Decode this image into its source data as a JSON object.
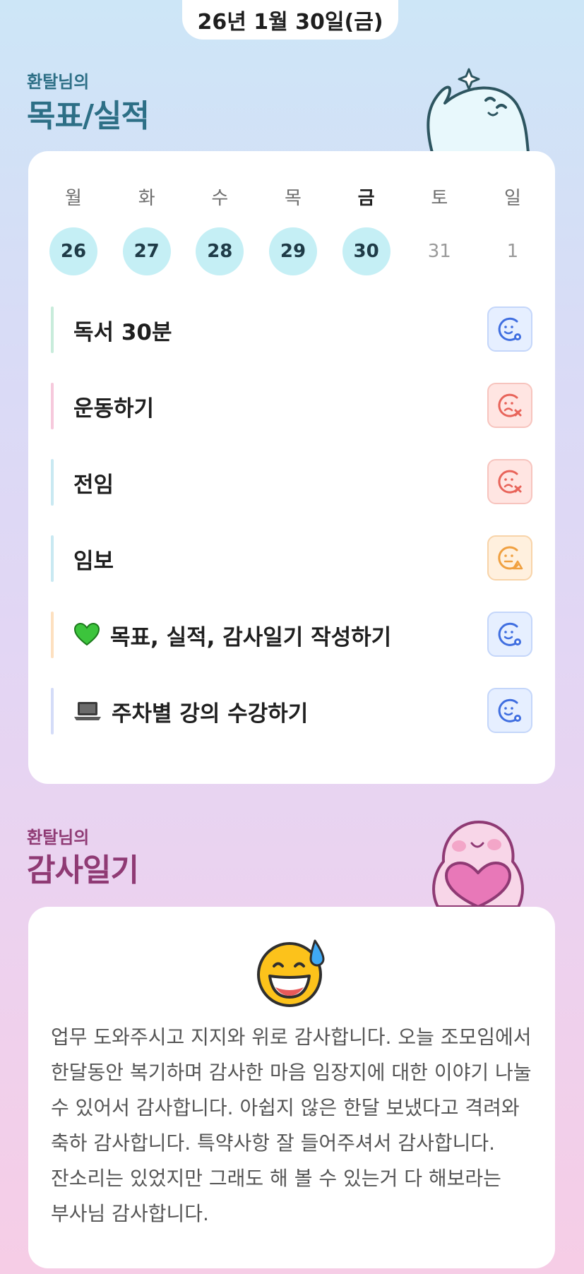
{
  "header": {
    "date": "26년 1월 30일(금)"
  },
  "goals_section": {
    "owner_label": "환탈님의",
    "title": "목표/실적"
  },
  "calendar": {
    "weekdays": [
      "월",
      "화",
      "수",
      "목",
      "금",
      "토",
      "일"
    ],
    "dates": [
      "26",
      "27",
      "28",
      "29",
      "30",
      "31",
      "1"
    ],
    "today_index": 4
  },
  "goals": [
    {
      "label": "독서 30분",
      "status": "success",
      "bar_color": "#c8ecdb"
    },
    {
      "label": "운동하기",
      "status": "fail",
      "bar_color": "#f6c9dc"
    },
    {
      "label": "전임",
      "status": "fail",
      "bar_color": "#c9e9f2"
    },
    {
      "label": "임보",
      "status": "partial",
      "bar_color": "#c9e9f2"
    },
    {
      "label": "목표, 실적, 감사일기 작성하기",
      "emoji": "green-heart-icon",
      "status": "success",
      "bar_color": "#fde0c0"
    },
    {
      "label": "주차별 강의 수강하기",
      "emoji": "laptop-icon",
      "status": "success",
      "bar_color": "#d4dcf8"
    }
  ],
  "status_colors": {
    "success": "#3f6ee0",
    "fail": "#e8645a",
    "partial": "#f0a040"
  },
  "gratitude_section": {
    "owner_label": "환탈님의",
    "title": "감사일기"
  },
  "gratitude": {
    "mood_icon": "grinning-sweat-face-icon",
    "text": "업무 도와주시고 지지와 위로 감사합니다. 오늘 조모임에서 한달동안 복기하며 감사한 마음 임장지에 대한 이야기 나눌 수 있어서 감사합니다. 아쉽지 않은 한달 보냈다고 격려와 축하 감사합니다. 특약사항 잘 들어주셔서 감사합니다. 잔소리는 있었지만 그래도 해 볼 수 있는거 다 해보라는 부사님 감사합니다."
  }
}
